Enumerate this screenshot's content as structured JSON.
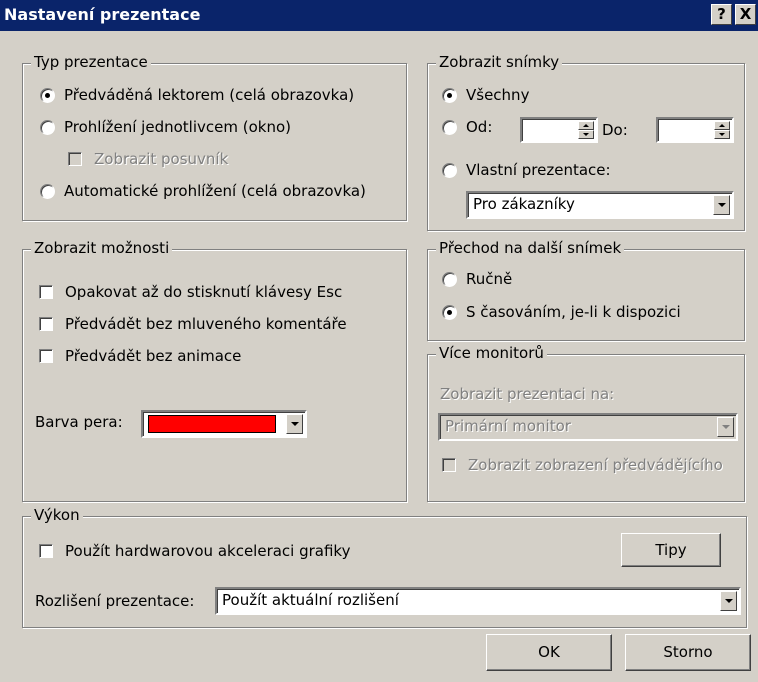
{
  "window": {
    "title": "Nastavení prezentace",
    "help_btn": "?",
    "close_btn": "X"
  },
  "typ": {
    "legend": "Typ prezentace",
    "options": [
      "Předváděná lektorem (celá obrazovka)",
      "Prohlížení jednotlivcem (okno)",
      "Automatické prohlížení (celá obrazovka)"
    ],
    "selected_index": 0,
    "scrollbar_checkbox": "Zobrazit posuvník"
  },
  "snimky": {
    "legend": "Zobrazit snímky",
    "all_label": "Všechny",
    "from_label": "Od:",
    "from_value": "",
    "to_label": "Do:",
    "to_value": "",
    "custom_label": "Vlastní prezentace:",
    "custom_value": "Pro zákazníky",
    "selected": "all"
  },
  "moznosti": {
    "legend": "Zobrazit možnosti",
    "checks": [
      "Opakovat až do stisknutí klávesy Esc",
      "Předvádět bez mluveného komentáře",
      "Předvádět bez animace"
    ],
    "pen_label": "Barva pera:",
    "pen_color": "#ff0000"
  },
  "prechod": {
    "legend": "Přechod na další snímek",
    "manual": "Ručně",
    "timed": "S časováním, je-li k dispozici",
    "selected": "timed"
  },
  "monitory": {
    "legend": "Více monitorů",
    "show_on_label": "Zobrazit prezentaci na:",
    "monitor_value": "Primární monitor",
    "presenter_view": "Zobrazit zobrazení předvádějícího"
  },
  "vykon": {
    "legend": "Výkon",
    "hw_accel": "Použít hardwarovou akceleraci grafiky",
    "tips_btn": "Tipy",
    "resolution_label": "Rozlišení prezentace:",
    "resolution_value": "Použít aktuální rozlišení"
  },
  "buttons": {
    "ok": "OK",
    "cancel": "Storno"
  }
}
